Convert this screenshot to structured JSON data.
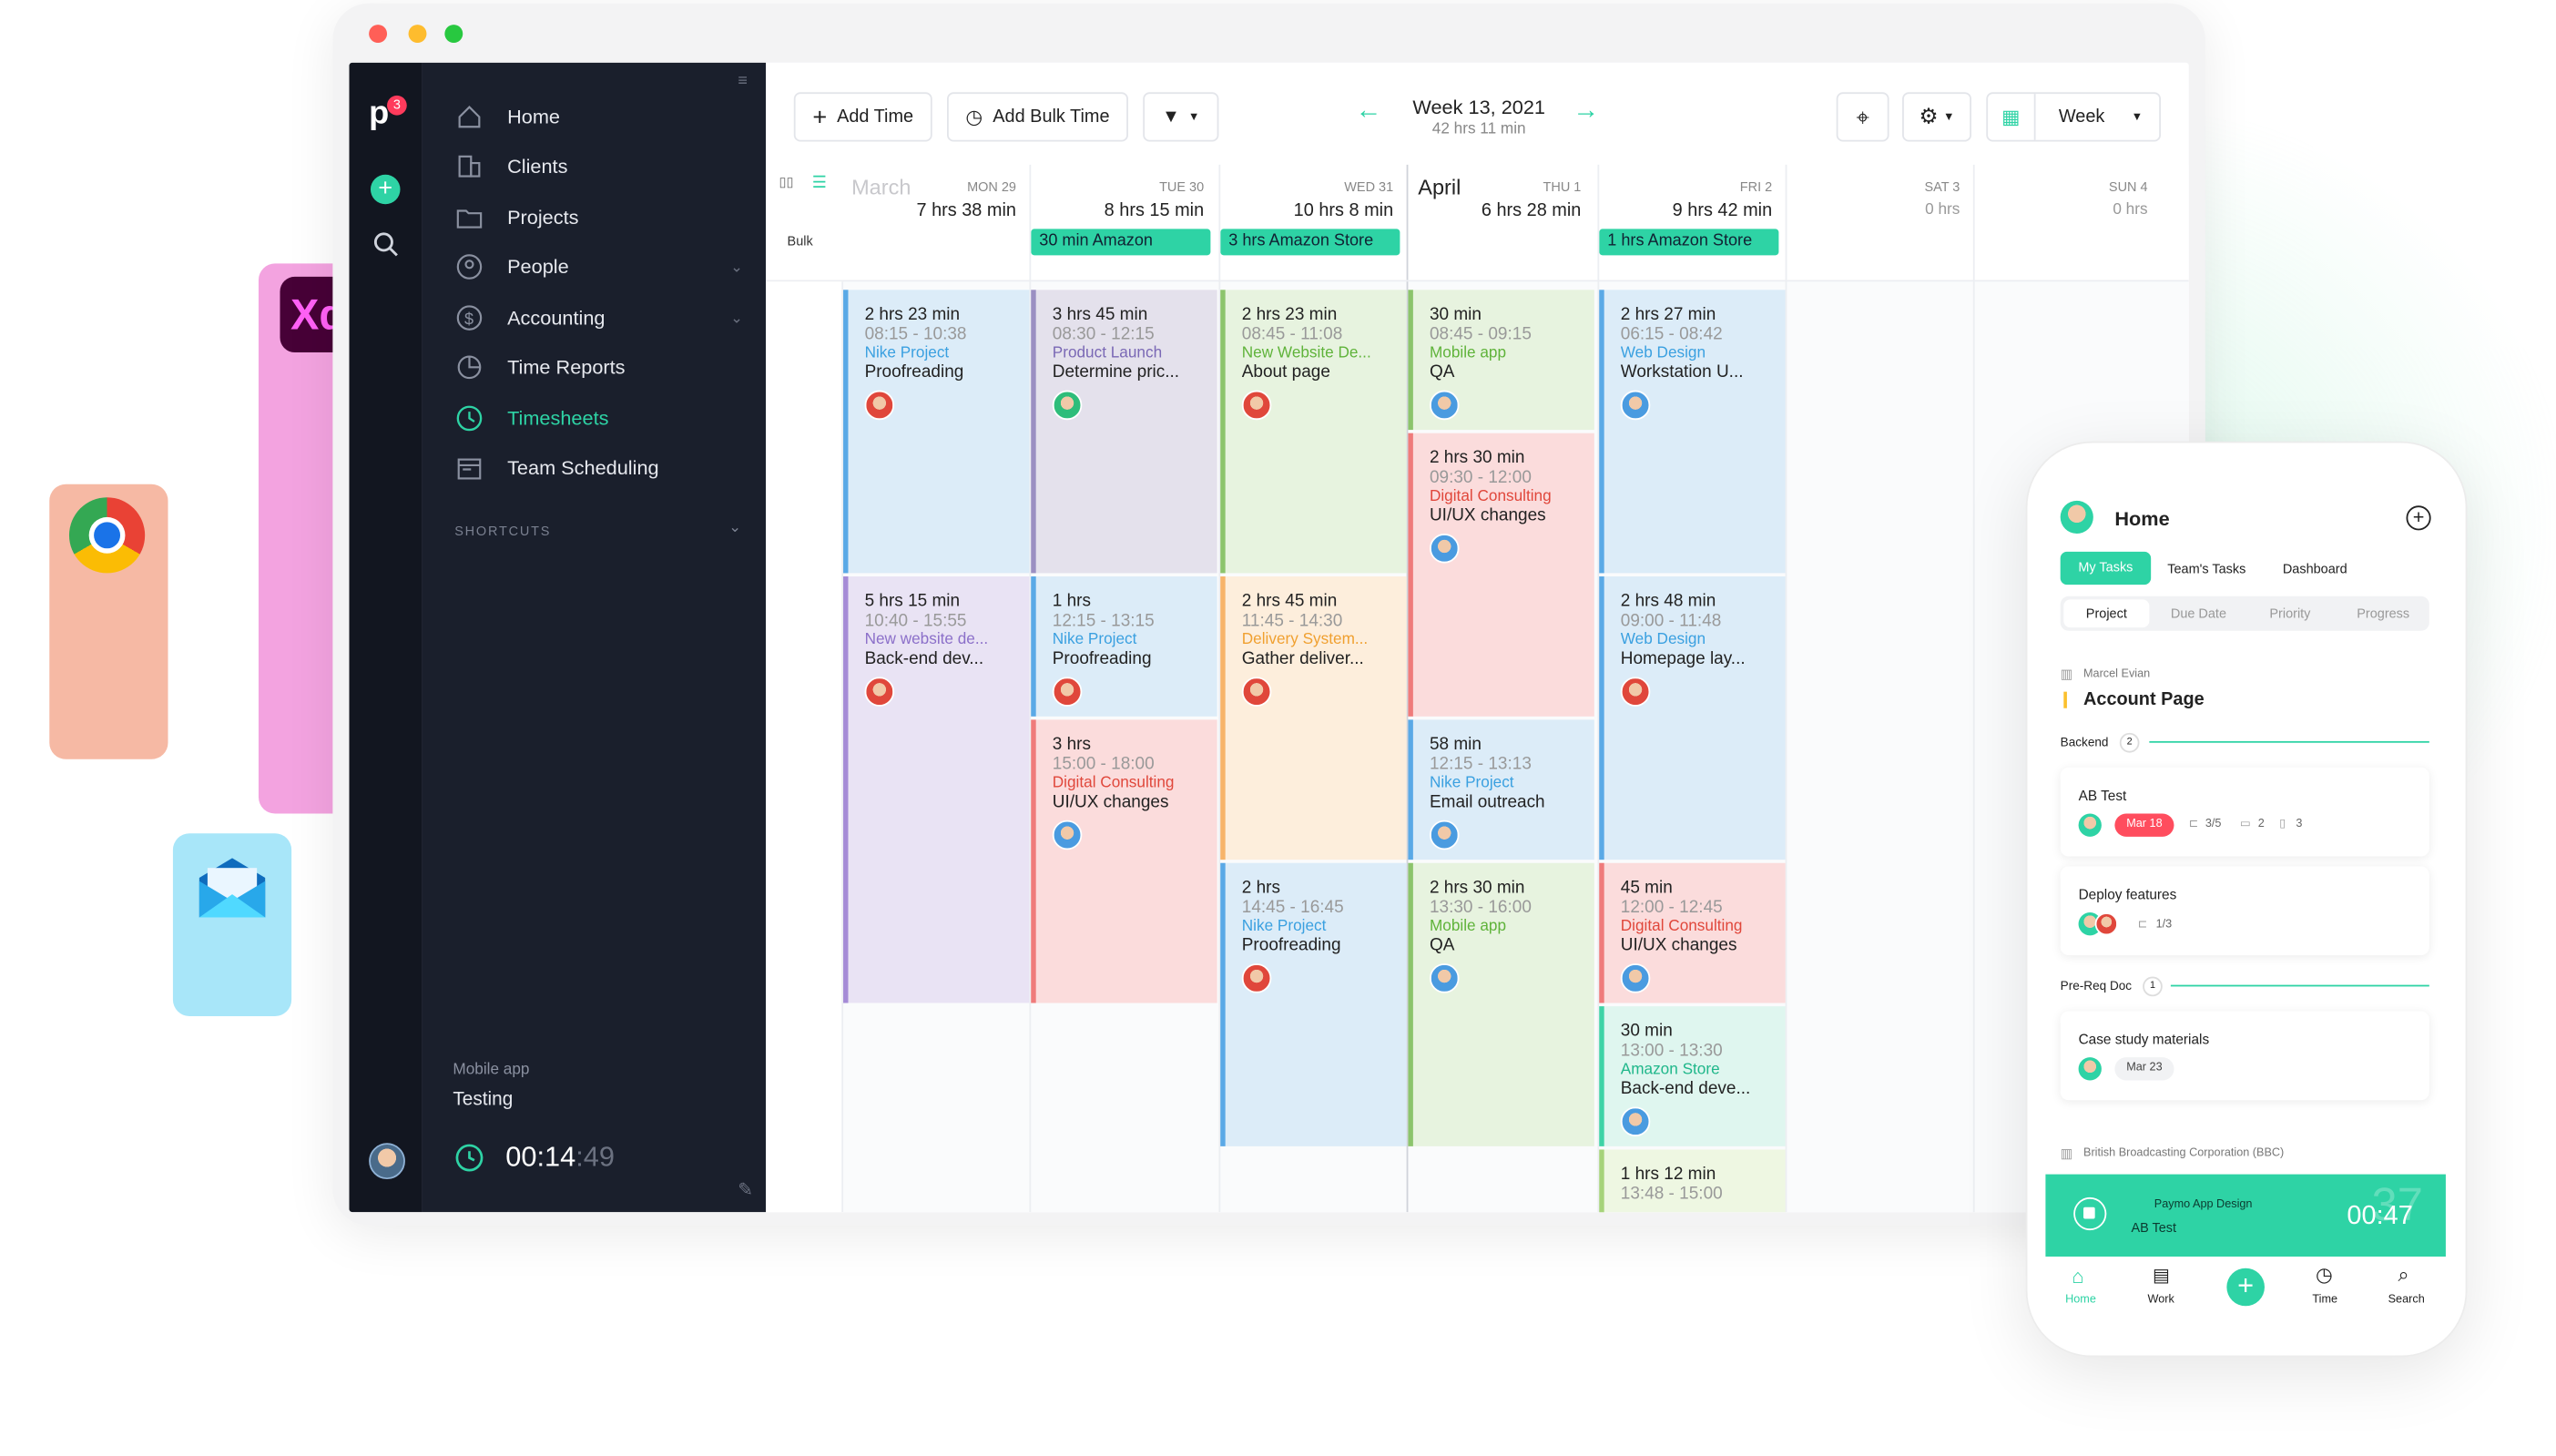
{
  "colors": {
    "accent": "#2ed3a5",
    "nav_bg": "#1a1f2c",
    "rail_bg": "#121620",
    "badge": "#ff3b5c"
  },
  "rail": {
    "logo": "p",
    "badge_count": "3"
  },
  "nav": {
    "items": [
      {
        "label": "Home",
        "icon": "home-icon"
      },
      {
        "label": "Clients",
        "icon": "building-icon"
      },
      {
        "label": "Projects",
        "icon": "folder-icon"
      },
      {
        "label": "People",
        "icon": "person-icon"
      },
      {
        "label": "Accounting",
        "icon": "dollar-icon"
      },
      {
        "label": "Time Reports",
        "icon": "pie-chart-icon"
      },
      {
        "label": "Timesheets",
        "icon": "clock-icon"
      },
      {
        "label": "Team Scheduling",
        "icon": "calendar-icon"
      }
    ],
    "shortcuts": "SHORTCUTS",
    "timer_project": "Mobile app",
    "timer_task": "Testing",
    "timer_hm": "00:14",
    "timer_s": ":49"
  },
  "toolbar": {
    "add_time": "Add Time",
    "add_bulk_time": "Add Bulk Time",
    "week_title": "Week 13, 2021",
    "week_total": "42 hrs 11 min",
    "view": "Week"
  },
  "calendar": {
    "month_march": "March",
    "month_april": "April",
    "bulk_label": "Bulk",
    "days": [
      {
        "name": "MON 29",
        "total": "7 hrs 38 min"
      },
      {
        "name": "TUE 30",
        "total": "8 hrs 15 min"
      },
      {
        "name": "WED 31",
        "total": "10 hrs 8 min"
      },
      {
        "name": "THU 1",
        "total": "6 hrs 28 min"
      },
      {
        "name": "FRI 2",
        "total": "9 hrs 42 min"
      },
      {
        "name": "SAT 3",
        "total": "0 hrs"
      },
      {
        "name": "SUN 4",
        "total": "0 hrs"
      }
    ],
    "bulk_tags": [
      "30 min Amazon",
      "3 hrs Amazon Store",
      "1 hrs Amazon Store"
    ],
    "entries": [
      {
        "duration": "2 hrs 23 min",
        "time": "08:15 - 10:38",
        "project": "Nike Project",
        "task": "Proofreading"
      },
      {
        "duration": "5 hrs 15 min",
        "time": "10:40 - 15:55",
        "project": "New website de...",
        "task": "Back-end dev..."
      },
      {
        "duration": "3 hrs 45 min",
        "time": "08:30 - 12:15",
        "project": "Product Launch",
        "task": "Determine pric..."
      },
      {
        "duration": "1 hrs",
        "time": "12:15 - 13:15",
        "project": "Nike Project",
        "task": "Proofreading"
      },
      {
        "duration": "3 hrs",
        "time": "15:00 - 18:00",
        "project": "Digital Consulting",
        "task": "UI/UX changes"
      },
      {
        "duration": "2 hrs 23 min",
        "time": "08:45 - 11:08",
        "project": "New Website De...",
        "task": "About page"
      },
      {
        "duration": "2 hrs 45 min",
        "time": "11:45 - 14:30",
        "project": "Delivery System...",
        "task": "Gather deliver..."
      },
      {
        "duration": "2 hrs",
        "time": "14:45 - 16:45",
        "project": "Nike Project",
        "task": "Proofreading"
      },
      {
        "duration": "30 min",
        "time": "08:45 - 09:15",
        "project": "Mobile app",
        "task": "QA"
      },
      {
        "duration": "2 hrs 30 min",
        "time": "09:30 - 12:00",
        "project": "Digital Consulting",
        "task": "UI/UX changes"
      },
      {
        "duration": "58 min",
        "time": "12:15 - 13:13",
        "project": "Nike Project",
        "task": "Email outreach"
      },
      {
        "duration": "2 hrs 30 min",
        "time": "13:30 - 16:00",
        "project": "Mobile app",
        "task": "QA"
      },
      {
        "duration": "2 hrs 27 min",
        "time": "06:15 - 08:42",
        "project": "Web Design",
        "task": "Workstation U..."
      },
      {
        "duration": "2 hrs 48 min",
        "time": "09:00 - 11:48",
        "project": "Web Design",
        "task": "Homepage lay..."
      },
      {
        "duration": "45 min",
        "time": "12:00 - 12:45",
        "project": "Digital Consulting",
        "task": "UI/UX changes"
      },
      {
        "duration": "30 min",
        "time": "13:00 - 13:30",
        "project": "Amazon Store",
        "task": "Back-end deve..."
      },
      {
        "duration": "1 hrs 12 min",
        "time": "13:48 - 15:00",
        "project": "",
        "task": ""
      }
    ]
  },
  "dock": {
    "xd_label": "Xd"
  },
  "phone": {
    "title": "Home",
    "tabs": [
      "My Tasks",
      "Team's Tasks",
      "Dashboard"
    ],
    "segments": [
      "Project",
      "Due Date",
      "Priority",
      "Progress"
    ],
    "client": "Marcel Evian",
    "project": "Account Page",
    "section1": "Backend",
    "section1_count": "2",
    "task1": "AB Test",
    "task1_date": "Mar 18",
    "task1_sub": "3/5",
    "task1_comments": "2",
    "task1_files": "3",
    "task2": "Deploy features",
    "task2_sub": "1/3",
    "section2": "Pre-Req Doc",
    "section2_count": "1",
    "task3": "Case study materials",
    "task3_date": "Mar 23",
    "client2": "British Broadcasting Corporation (BBC)",
    "timer_project": "Paymo App Design",
    "timer_task": "AB Test",
    "timer_value": "00:47",
    "timer_faded": "37",
    "bottom_nav": [
      "Home",
      "Work",
      "Time",
      "Search"
    ]
  }
}
